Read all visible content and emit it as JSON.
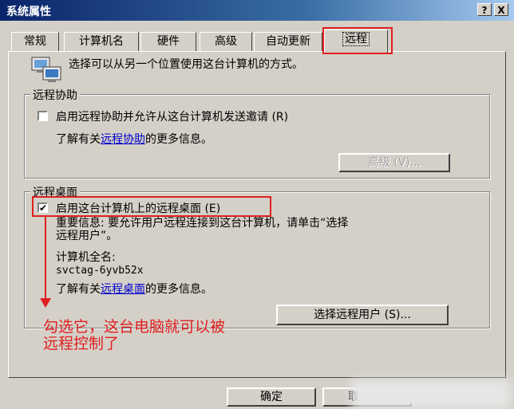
{
  "window": {
    "title": "系统属性",
    "help_btn": "?",
    "close_btn": "X"
  },
  "tabs": [
    {
      "label": "常规"
    },
    {
      "label": "计算机名"
    },
    {
      "label": "硬件"
    },
    {
      "label": "高级"
    },
    {
      "label": "自动更新"
    },
    {
      "label": "远程",
      "active": true
    }
  ],
  "intro_text": "选择可以从另一个位置使用这台计算机的方式。",
  "remote_assistance": {
    "group_label": "远程协助",
    "checkbox_label": "启用远程协助并允许从这台计算机发送邀请 (R)",
    "checked": false,
    "more_info_prefix": "了解有关",
    "more_info_link": "远程协助",
    "more_info_suffix": "的更多信息。",
    "advanced_button": "高级 (V)..."
  },
  "remote_desktop": {
    "group_label": "远程桌面",
    "checkbox_label": "启用这台计算机上的远程桌面 (E)",
    "checkbox_mark": "✔",
    "checked": true,
    "important_line1": "重要信息: 要允许用户远程连接到这台计算机，请单击“选择",
    "important_line2": "远程用户”。",
    "fullname_label": "计算机全名:",
    "fullname_value": "svctag-6yvb52x",
    "more_info_prefix": "了解有关",
    "more_info_link": "远程桌面",
    "more_info_suffix": "的更多信息。",
    "select_users_button": "选择远程用户 (S)..."
  },
  "annotation": {
    "line1": "勾选它，这台电脑就可以被",
    "line2": "远程控制了",
    "color": "#e02020"
  },
  "footer": {
    "ok_button": "确定",
    "cancel_button_partial": "取"
  }
}
